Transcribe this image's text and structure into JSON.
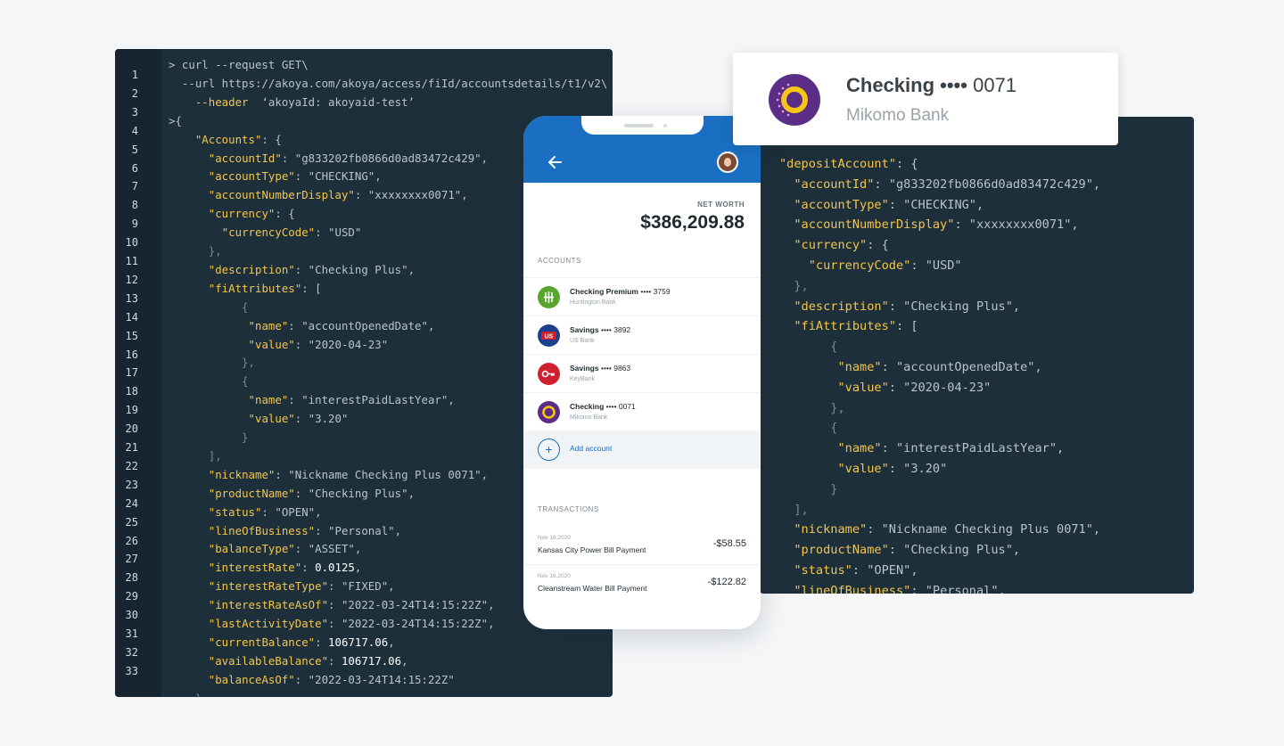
{
  "left_code": {
    "line_numbers": [
      "1",
      "2",
      "3",
      "4",
      "5",
      "6",
      "7",
      "8",
      "9",
      "10",
      "11",
      "12",
      "13",
      "14",
      "15",
      "16",
      "17",
      "18",
      "19",
      "20",
      "21",
      "22",
      "23",
      "24",
      "25",
      "26",
      "27",
      "28",
      "29",
      "30",
      "31",
      "32",
      "33"
    ],
    "lines": [
      [
        {
          "t": "> curl --request GET\\",
          "c": "s"
        }
      ],
      [
        {
          "t": "  --url https://akoya.com/akoya/access/fiId/accountsdetails/t1/v2\\",
          "c": "s"
        }
      ],
      [
        {
          "t": "    --header  ",
          "c": "k"
        },
        {
          "t": "‘akoyaId: akoyaid-test’",
          "c": "s"
        }
      ],
      [
        {
          "t": ">{",
          "c": "s"
        }
      ],
      [
        {
          "t": "    ",
          "c": "s"
        },
        {
          "t": "\"Accounts\"",
          "c": "k"
        },
        {
          "t": ": {",
          "c": "s"
        }
      ],
      [
        {
          "t": "      ",
          "c": "s"
        },
        {
          "t": "\"accountId\"",
          "c": "k"
        },
        {
          "t": ": \"g833202fb0866d0ad83472c429\",",
          "c": "s"
        }
      ],
      [
        {
          "t": "      ",
          "c": "s"
        },
        {
          "t": "\"accountType\"",
          "c": "k"
        },
        {
          "t": ": \"CHECKING\",",
          "c": "s"
        }
      ],
      [
        {
          "t": "      ",
          "c": "s"
        },
        {
          "t": "\"accountNumberDisplay\"",
          "c": "k"
        },
        {
          "t": ": \"xxxxxxxx0071\",",
          "c": "s"
        }
      ],
      [
        {
          "t": "      ",
          "c": "s"
        },
        {
          "t": "\"currency\"",
          "c": "k"
        },
        {
          "t": ": {",
          "c": "s"
        }
      ],
      [
        {
          "t": "        ",
          "c": "s"
        },
        {
          "t": "\"currencyCode\"",
          "c": "k"
        },
        {
          "t": ": \"USD\"",
          "c": "s"
        }
      ],
      [
        {
          "t": "      },",
          "c": "p"
        }
      ],
      [
        {
          "t": "      ",
          "c": "s"
        },
        {
          "t": "\"description\"",
          "c": "k"
        },
        {
          "t": ": \"Checking Plus\",",
          "c": "s"
        }
      ],
      [
        {
          "t": "      ",
          "c": "s"
        },
        {
          "t": "\"fiAttributes\"",
          "c": "k"
        },
        {
          "t": ": [",
          "c": "s"
        }
      ],
      [
        {
          "t": "           {",
          "c": "p"
        }
      ],
      [
        {
          "t": "            ",
          "c": "s"
        },
        {
          "t": "\"name\"",
          "c": "k"
        },
        {
          "t": ": \"accountOpenedDate\",",
          "c": "s"
        }
      ],
      [
        {
          "t": "            ",
          "c": "s"
        },
        {
          "t": "\"value\"",
          "c": "k"
        },
        {
          "t": ": \"2020-04-23\"",
          "c": "s"
        }
      ],
      [
        {
          "t": "           },",
          "c": "p"
        }
      ],
      [
        {
          "t": "           {",
          "c": "p"
        }
      ],
      [
        {
          "t": "            ",
          "c": "s"
        },
        {
          "t": "\"name\"",
          "c": "k"
        },
        {
          "t": ": \"interestPaidLastYear\",",
          "c": "s"
        }
      ],
      [
        {
          "t": "            ",
          "c": "s"
        },
        {
          "t": "\"value\"",
          "c": "k"
        },
        {
          "t": ": \"3.20\"",
          "c": "s"
        }
      ],
      [
        {
          "t": "           }",
          "c": "p"
        }
      ],
      [
        {
          "t": "      ],",
          "c": "p"
        }
      ],
      [
        {
          "t": "      ",
          "c": "s"
        },
        {
          "t": "\"nickname\"",
          "c": "k"
        },
        {
          "t": ": \"Nickname Checking Plus 0071\",",
          "c": "s"
        }
      ],
      [
        {
          "t": "      ",
          "c": "s"
        },
        {
          "t": "\"productName\"",
          "c": "k"
        },
        {
          "t": ": \"Checking Plus\",",
          "c": "s"
        }
      ],
      [
        {
          "t": "      ",
          "c": "s"
        },
        {
          "t": "\"status\"",
          "c": "k"
        },
        {
          "t": ": \"OPEN\",",
          "c": "s"
        }
      ],
      [
        {
          "t": "      ",
          "c": "s"
        },
        {
          "t": "\"lineOfBusiness\"",
          "c": "k"
        },
        {
          "t": ": \"Personal\",",
          "c": "s"
        }
      ],
      [
        {
          "t": "      ",
          "c": "s"
        },
        {
          "t": "\"balanceType\"",
          "c": "k"
        },
        {
          "t": ": \"ASSET\",",
          "c": "s"
        }
      ],
      [
        {
          "t": "      ",
          "c": "s"
        },
        {
          "t": "\"interestRate\"",
          "c": "k"
        },
        {
          "t": ": ",
          "c": "s"
        },
        {
          "t": "0.0125",
          "c": "n"
        },
        {
          "t": ",",
          "c": "s"
        }
      ],
      [
        {
          "t": "      ",
          "c": "s"
        },
        {
          "t": "\"interestRateType\"",
          "c": "k"
        },
        {
          "t": ": \"FIXED\",",
          "c": "s"
        }
      ],
      [
        {
          "t": "      ",
          "c": "s"
        },
        {
          "t": "\"interestRateAsOf\"",
          "c": "k"
        },
        {
          "t": ": \"2022-03-24T14:15:22Z\",",
          "c": "s"
        }
      ],
      [
        {
          "t": "      ",
          "c": "s"
        },
        {
          "t": "\"lastActivityDate\"",
          "c": "k"
        },
        {
          "t": ": \"2022-03-24T14:15:22Z\",",
          "c": "s"
        }
      ],
      [
        {
          "t": "      ",
          "c": "s"
        },
        {
          "t": "\"currentBalance\"",
          "c": "k"
        },
        {
          "t": ": ",
          "c": "s"
        },
        {
          "t": "106717.06",
          "c": "n"
        },
        {
          "t": ",",
          "c": "s"
        }
      ],
      [
        {
          "t": "      ",
          "c": "s"
        },
        {
          "t": "\"availableBalance\"",
          "c": "k"
        },
        {
          "t": ": ",
          "c": "s"
        },
        {
          "t": "106717.06",
          "c": "n"
        },
        {
          "t": ",",
          "c": "s"
        }
      ],
      [
        {
          "t": "      ",
          "c": "s"
        },
        {
          "t": "\"balanceAsOf\"",
          "c": "k"
        },
        {
          "t": ": \"2022-03-24T14:15:22Z\"",
          "c": "s"
        }
      ],
      [
        {
          "t": "    }",
          "c": "p"
        }
      ]
    ]
  },
  "right_code": {
    "lines": [
      [
        {
          "t": "\"depositAccount\"",
          "c": "k"
        },
        {
          "t": ": {",
          "c": "s"
        }
      ],
      [
        {
          "t": "  ",
          "c": "s"
        },
        {
          "t": "\"accountId\"",
          "c": "k"
        },
        {
          "t": ": \"g833202fb0866d0ad83472c429\",",
          "c": "s"
        }
      ],
      [
        {
          "t": "  ",
          "c": "s"
        },
        {
          "t": "\"accountType\"",
          "c": "k"
        },
        {
          "t": ": \"CHECKING\",",
          "c": "s"
        }
      ],
      [
        {
          "t": "  ",
          "c": "s"
        },
        {
          "t": "\"accountNumberDisplay\"",
          "c": "k"
        },
        {
          "t": ": \"xxxxxxxx0071\",",
          "c": "s"
        }
      ],
      [
        {
          "t": "  ",
          "c": "s"
        },
        {
          "t": "\"currency\"",
          "c": "k"
        },
        {
          "t": ": {",
          "c": "s"
        }
      ],
      [
        {
          "t": "    ",
          "c": "s"
        },
        {
          "t": "\"currencyCode\"",
          "c": "k"
        },
        {
          "t": ": \"USD\"",
          "c": "s"
        }
      ],
      [
        {
          "t": "  },",
          "c": "p"
        }
      ],
      [
        {
          "t": "  ",
          "c": "s"
        },
        {
          "t": "\"description\"",
          "c": "k"
        },
        {
          "t": ": \"Checking Plus\",",
          "c": "s"
        }
      ],
      [
        {
          "t": "  ",
          "c": "s"
        },
        {
          "t": "\"fiAttributes\"",
          "c": "k"
        },
        {
          "t": ": [",
          "c": "s"
        }
      ],
      [
        {
          "t": "       {",
          "c": "p"
        }
      ],
      [
        {
          "t": "        ",
          "c": "s"
        },
        {
          "t": "\"name\"",
          "c": "k"
        },
        {
          "t": ": \"accountOpenedDate\",",
          "c": "s"
        }
      ],
      [
        {
          "t": "        ",
          "c": "s"
        },
        {
          "t": "\"value\"",
          "c": "k"
        },
        {
          "t": ": \"2020-04-23\"",
          "c": "s"
        }
      ],
      [
        {
          "t": "       },",
          "c": "p"
        }
      ],
      [
        {
          "t": "       {",
          "c": "p"
        }
      ],
      [
        {
          "t": "        ",
          "c": "s"
        },
        {
          "t": "\"name\"",
          "c": "k"
        },
        {
          "t": ": \"interestPaidLastYear\",",
          "c": "s"
        }
      ],
      [
        {
          "t": "        ",
          "c": "s"
        },
        {
          "t": "\"value\"",
          "c": "k"
        },
        {
          "t": ": \"3.20\"",
          "c": "s"
        }
      ],
      [
        {
          "t": "       }",
          "c": "p"
        }
      ],
      [
        {
          "t": "  ],",
          "c": "p"
        }
      ],
      [
        {
          "t": "  ",
          "c": "s"
        },
        {
          "t": "\"nickname\"",
          "c": "k"
        },
        {
          "t": ": \"Nickname Checking Plus 0071\",",
          "c": "s"
        }
      ],
      [
        {
          "t": "  ",
          "c": "s"
        },
        {
          "t": "\"productName\"",
          "c": "k"
        },
        {
          "t": ": \"Checking Plus\",",
          "c": "s"
        }
      ],
      [
        {
          "t": "  ",
          "c": "s"
        },
        {
          "t": "\"status\"",
          "c": "k"
        },
        {
          "t": ": \"OPEN\",",
          "c": "s"
        }
      ],
      [
        {
          "t": "  ",
          "c": "s"
        },
        {
          "t": "\"lineOfBusiness\"",
          "c": "k"
        },
        {
          "t": ": \"Personal\",",
          "c": "s"
        }
      ]
    ]
  },
  "account_card": {
    "title": "Checking",
    "mask": "••••",
    "number": "0071",
    "bank": "Mikomo Bank",
    "logo_color": "#5b2d86",
    "logo_accent": "#f5c518"
  },
  "phone": {
    "header_color": "#1a6fc2",
    "back_icon": "arrow-left-icon",
    "net_worth_label": "NET WORTH",
    "net_worth_value": "$386,209.88",
    "accounts_label": "ACCOUNTS",
    "accounts": [
      {
        "name": "Checking Premium",
        "mask": "•••• 3759",
        "bank": "Huntington Bank",
        "icon": "huntington-logo-icon",
        "color": "#5aa52f"
      },
      {
        "name": "Savings",
        "mask": "•••• 3892",
        "bank": "US Bank",
        "icon": "usbank-logo-icon",
        "color": "#1c3f8f"
      },
      {
        "name": "Savings",
        "mask": "•••• 9863",
        "bank": "KeyBank",
        "icon": "keybank-logo-icon",
        "color": "#d0202e"
      },
      {
        "name": "Checking",
        "mask": "•••• 0071",
        "bank": "Mikomo Bank",
        "icon": "mikomo-logo-icon",
        "color": "#5b2d86"
      }
    ],
    "add_account_label": "Add account",
    "transactions_label": "TRANSACTIONS",
    "transactions": [
      {
        "date": "Nov 16,2020",
        "name": "Kansas City Power Bill Payment",
        "amount": "-$58.55"
      },
      {
        "date": "Nov 16,2020",
        "name": "Cleanstream Water Bill Payment",
        "amount": "-$122.82"
      }
    ]
  }
}
